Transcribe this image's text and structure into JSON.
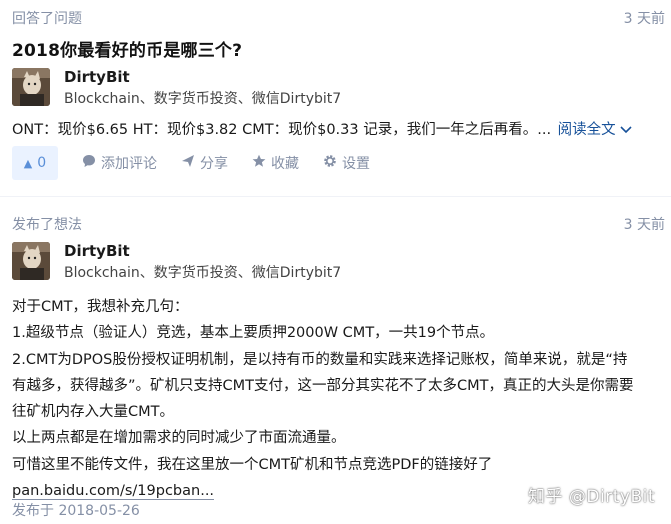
{
  "card1": {
    "action_label": "回答了问题",
    "time": "3 天前",
    "question_title": "2018你最看好的币是哪三个?",
    "author_name": "DirtyBit",
    "author_bio": "Blockchain、数字货币投资、微信Dirtybit7",
    "excerpt": "ONT：现价$6.65 HT：现价$3.82 CMT：现价$0.33 记录，我们一年之后再看。...",
    "read_more": "阅读全文",
    "read_more_icon": "chevron-down-icon",
    "vote_count": "0",
    "comment_label": "添加评论",
    "share_label": "分享",
    "favorite_label": "收藏",
    "settings_label": "设置"
  },
  "card2": {
    "action_label": "发布了想法",
    "time": "3 天前",
    "author_name": "DirtyBit",
    "author_bio": "Blockchain、数字货币投资、微信Dirtybit7",
    "lines": [
      "对于CMT，我想补充几句：",
      "1.超级节点（验证人）竞选，基本上要质押2000W CMT，一共19个节点。",
      "2.CMT为DPOS股份授权证明机制，是以持有币的数量和实践来选择记账权，简单来说，就是“持",
      "有越多，获得越多”。矿机只支持CMT支付，这一部分其实花不了太多CMT，真正的大头是你需要",
      "往矿机内存入大量CMT。",
      "以上两点都是在增加需求的同时减少了市面流通量。",
      "可惜这里不能传文件，我在这里放一个CMT矿机和节点竞选PDF的链接好了"
    ],
    "link_text": "pan.baidu.com/s/19pcban...",
    "posted_date": "发布于 2018-05-26"
  },
  "watermark": "知乎 @DirtyBit",
  "colors": {
    "meta_gray": "#8590a6",
    "link_blue": "#175199",
    "vote_bg": "#eaf2ff",
    "vote_blue": "#5a8fd8"
  }
}
